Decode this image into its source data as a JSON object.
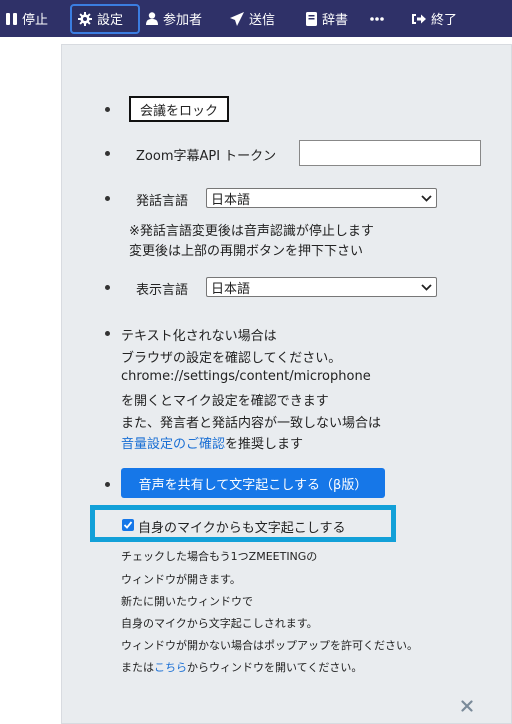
{
  "toolbar": {
    "items": [
      {
        "label": "停止",
        "icon": "pause-icon"
      },
      {
        "label": "設定",
        "icon": "gear-icon"
      },
      {
        "label": "参加者",
        "icon": "user-icon"
      },
      {
        "label": "送信",
        "icon": "send-icon"
      },
      {
        "label": "辞書",
        "icon": "book-icon"
      },
      {
        "label": "",
        "icon": "more-icon"
      },
      {
        "label": "終了",
        "icon": "sign-out-icon"
      }
    ],
    "active_item": "設定"
  },
  "settings": {
    "lock_button": "会議をロック",
    "zoom_token_label": "Zoom字幕API トークン",
    "zoom_token_value": "",
    "speech_lang_label": "発話言語",
    "speech_lang_value": "日本語",
    "speech_lang_note_1": "※発話言語変更後は音声認識が停止します",
    "speech_lang_note_2": "変更後は上部の再開ボタンを押下下さい",
    "display_lang_label": "表示言語",
    "display_lang_value": "日本語",
    "mic_help_1": "テキスト化されない場合は",
    "mic_help_2": "ブラウザの設定を確認してください。",
    "mic_help_3": "chrome://settings/content/microphone",
    "mic_help_4": "を開くとマイク設定を確認できます",
    "mic_help_5": "また、発言者と発話内容が一致しない場合は",
    "volume_link": "音量設定のご確認",
    "volume_suffix": "を推奨します",
    "share_button": "音声を共有して文字起こしする（β版）",
    "own_mic_label": "自身のマイクからも文字起こしする",
    "own_mic_checked": true,
    "note_1": "チェックした場合もう1つZMEETINGの",
    "note_2": "ウィンドウが開きます。",
    "note_3": "新たに開いたウィンドウで",
    "note_4": "自身のマイクから文字起こしされます。",
    "note_5": "ウィンドウが開かない場合はポップアップを許可ください。",
    "note_6_prefix": "または",
    "note_6_link": "こちら",
    "note_6_suffix": "からウィンドウを開いてください。",
    "close_icon": "close-icon"
  },
  "colors": {
    "toolbar_bg": "#2f3168",
    "panel_bg": "#e9ecef",
    "primary": "#1677e8",
    "highlight": "#12a0d8",
    "link": "#1a6fd4"
  }
}
